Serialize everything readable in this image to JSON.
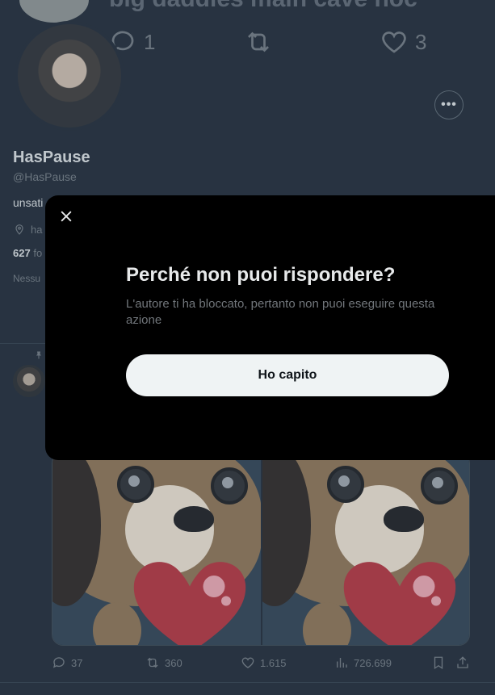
{
  "top_tweet": {
    "text": "big daddies main cave hoc",
    "replies": "1",
    "likes": "3"
  },
  "profile": {
    "name": "HasPause",
    "handle": "@HasPause",
    "bio_partial": "unsati",
    "location_partial": "ha",
    "followers_count": "627",
    "followers_label_partial": "fo",
    "followed_by_partial": "Nessu",
    "more_icon": "ellipsis-icon"
  },
  "tweet": {
    "replies": "37",
    "retweets": "360",
    "likes": "1.615",
    "views": "726.699"
  },
  "modal": {
    "title": "Perché non puoi rispondere?",
    "body": "L'autore ti ha bloccato, pertanto non puoi eseguire questa azione",
    "button": "Ho capito",
    "close_icon": "close-icon"
  },
  "colors": {
    "background": "#1e2732",
    "modal_background": "#000000",
    "button_background": "#eff3f4",
    "muted_text": "#71767b"
  }
}
